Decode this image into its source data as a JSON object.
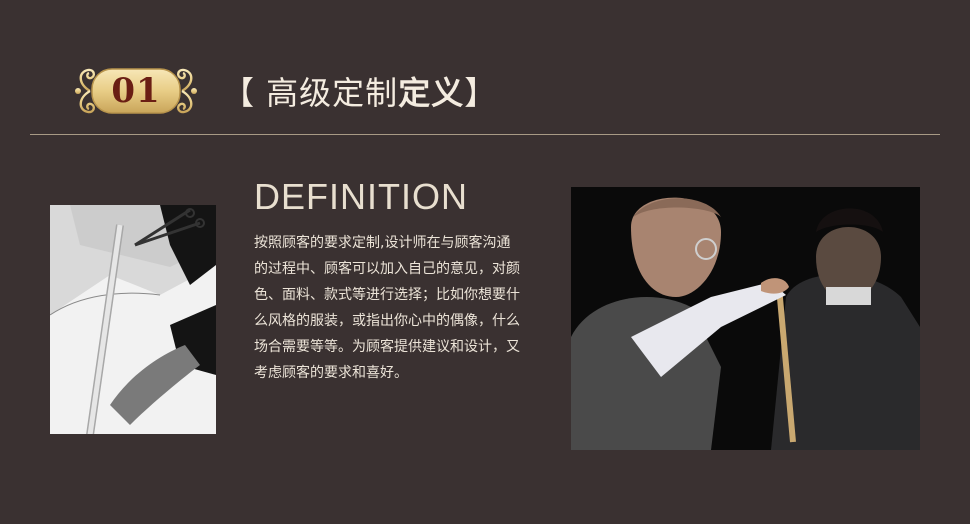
{
  "section": {
    "number": "01",
    "title_regular": "【 高级定制",
    "title_bold": "定义",
    "title_close": " 】"
  },
  "definition": {
    "heading": "DEFINITION",
    "lines": [
      "按照顾客的要求定制,设计师在与顾客沟通",
      "的过程中、顾客可以加入自己的意见，对颜",
      "色、面料、款式等进行选择；比如你想要什",
      "么风格的服装，或指出你心中的偶像，什么",
      "场合需要等等。为顾客提供建议和设计，又",
      "考虑顾客的要求和喜好。"
    ]
  },
  "colors": {
    "background": "#3a3131",
    "badge_gold": "#d8b868",
    "badge_number": "#6a1e14",
    "divider": "#a89a85"
  },
  "images": {
    "left": "tailor-cutting-fabric-photo",
    "right": "tailor-measuring-suit-photo"
  }
}
